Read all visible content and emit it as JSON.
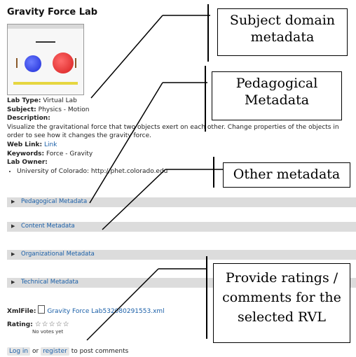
{
  "page": {
    "title": "Gravity Force Lab",
    "lab_type_label": "Lab Type:",
    "lab_type_value": "Virtual Lab",
    "subject_label": "Subject:",
    "subject_value": "Physics - Motion",
    "description_label": "Description:",
    "description_text": "Visualize the gravitational force that two objects exert on each other. Change properties of the objects in order to see how it changes the gravity force.",
    "web_link_label": "Web Link:",
    "web_link_text": "Link",
    "keywords_label": "Keywords:",
    "keywords_value": "Force - Gravity",
    "lab_owner_label": "Lab Owner:",
    "lab_owner_item": "University of Colorado: http://phet.colorado.edu"
  },
  "sections": [
    {
      "label": "Pedagogical Metadata"
    },
    {
      "label": "Content Metadata"
    },
    {
      "label": "Organizational Metadata"
    },
    {
      "label": "Technical Metadata"
    }
  ],
  "xml": {
    "label": "XmlFile:",
    "file": "Gravity Force Lab532080291553.xml"
  },
  "rating": {
    "label": "Rating:",
    "stars": "☆☆☆☆☆",
    "votes": "No votes yet"
  },
  "login": {
    "login_label": "Log in",
    "or_text": "or",
    "register_label": "register",
    "suffix": "to post comments"
  },
  "callouts": {
    "subject": "Subject domain metadata",
    "pedagogical": "Pedagogical Metadata",
    "other": "Other metadata",
    "ratings": "Provide ratings / comments for the selected RVL"
  },
  "icons": {
    "section_toggle": "triangle-right-icon",
    "file": "file-icon",
    "star": "star-outline-icon"
  }
}
